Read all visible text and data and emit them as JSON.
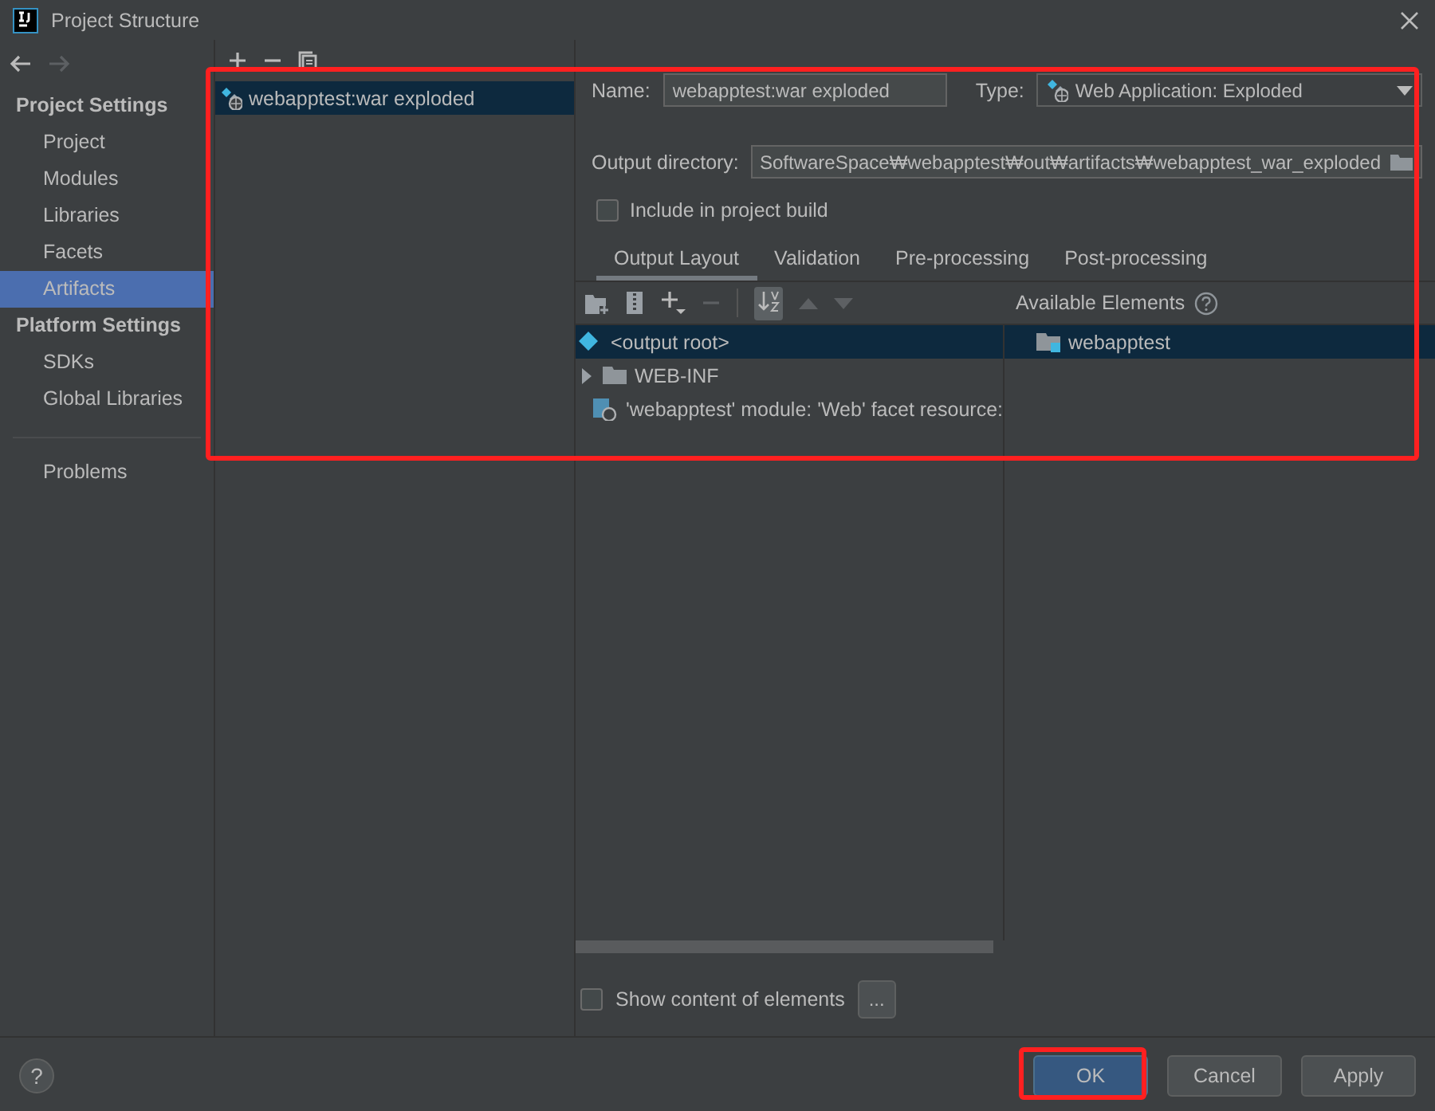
{
  "window": {
    "title": "Project Structure"
  },
  "sidebar": {
    "sections": [
      {
        "title": "Project Settings",
        "items": [
          {
            "label": "Project",
            "selected": false
          },
          {
            "label": "Modules",
            "selected": false
          },
          {
            "label": "Libraries",
            "selected": false
          },
          {
            "label": "Facets",
            "selected": false
          },
          {
            "label": "Artifacts",
            "selected": true
          }
        ]
      },
      {
        "title": "Platform Settings",
        "items": [
          {
            "label": "SDKs",
            "selected": false
          },
          {
            "label": "Global Libraries",
            "selected": false
          }
        ]
      }
    ],
    "extra_items": [
      {
        "label": "Problems",
        "selected": false
      }
    ]
  },
  "artifact_list": [
    {
      "label": "webapptest:war exploded",
      "selected": true
    }
  ],
  "editor": {
    "name_label": "Name:",
    "name_value": "webapptest:war exploded",
    "type_label": "Type:",
    "type_value": "Web Application: Exploded",
    "output_label": "Output directory:",
    "output_value": "SoftwareSpace₩webapptest₩out₩artifacts₩webapptest_war_exploded",
    "include_build": {
      "label": "Include in project build",
      "checked": false
    },
    "tabs": [
      {
        "label": "Output Layout",
        "selected": true
      },
      {
        "label": "Validation",
        "selected": false
      },
      {
        "label": "Pre-processing",
        "selected": false
      },
      {
        "label": "Post-processing",
        "selected": false
      }
    ],
    "available_title": "Available Elements",
    "layout_tree": [
      {
        "label": "<output root>",
        "kind": "root",
        "selected": true,
        "children": [
          {
            "label": "WEB-INF",
            "kind": "folder",
            "selected": false,
            "expanded": false
          },
          {
            "label": "'webapptest' module: 'Web' facet resource:",
            "kind": "module",
            "selected": false
          }
        ]
      }
    ],
    "available": [
      {
        "label": "webapptest",
        "kind": "module-folder",
        "selected": true
      }
    ],
    "show_content": {
      "label": "Show content of elements",
      "checked": false
    },
    "more_button": "..."
  },
  "buttons": [
    {
      "label": "OK",
      "kind": "primary"
    },
    {
      "label": "Cancel",
      "kind": "normal"
    },
    {
      "label": "Apply",
      "kind": "normal"
    }
  ],
  "help_button": "?",
  "highlights": {
    "editor": true,
    "ok_button": true
  }
}
